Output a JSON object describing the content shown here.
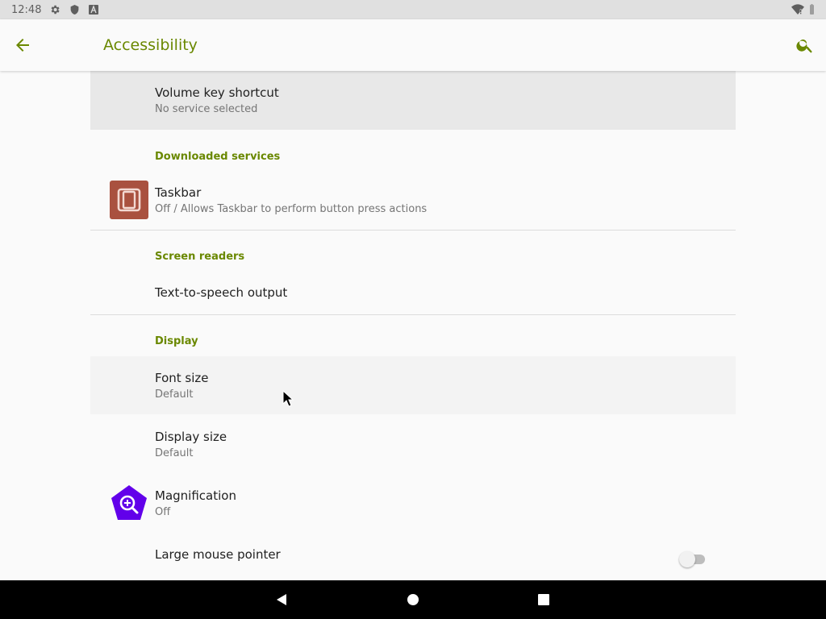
{
  "status_bar": {
    "time": "12:48",
    "icons": [
      "gear-icon",
      "shield-icon",
      "keyboard-a-icon",
      "wifi-icon",
      "battery-icon"
    ]
  },
  "app_bar": {
    "title": "Accessibility",
    "back_icon": "arrow-left-icon",
    "search_icon": "search-icon",
    "accent_color": "#6a8800"
  },
  "items": {
    "volume_key": {
      "title": "Volume key shortcut",
      "summary": "No service selected"
    },
    "downloaded_services": {
      "header": "Downloaded services"
    },
    "taskbar": {
      "title": "Taskbar",
      "summary": "Off / Allows Taskbar to perform button press actions",
      "icon": "taskbar-app-icon",
      "icon_color": "#a9513f"
    },
    "screen_readers": {
      "header": "Screen readers"
    },
    "tts": {
      "title": "Text-to-speech output"
    },
    "display": {
      "header": "Display"
    },
    "font_size": {
      "title": "Font size",
      "summary": "Default"
    },
    "display_size": {
      "title": "Display size",
      "summary": "Default"
    },
    "magnification": {
      "title": "Magnification",
      "summary": "Off",
      "icon": "magnification-icon",
      "icon_color": "#6200ea"
    },
    "large_pointer": {
      "title": "Large mouse pointer",
      "toggle_state": "off"
    }
  },
  "nav_bar": {
    "buttons": [
      "back-triangle-icon",
      "home-circle-icon",
      "recents-square-icon"
    ]
  }
}
